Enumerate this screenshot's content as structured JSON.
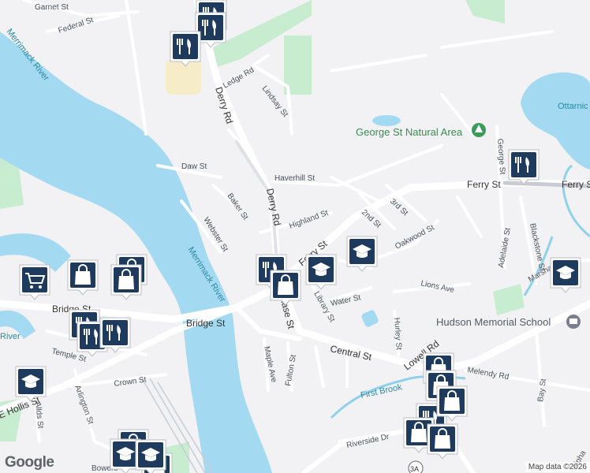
{
  "map": {
    "rivers": {
      "merrimack_top": "Merrimack River",
      "merrimack_mid": "Merrimack River",
      "river_edge": "River"
    },
    "water_bodies": {
      "ottarnic": "Ottarnic"
    },
    "brooks": {
      "first_brook": "First Brook"
    },
    "streets": {
      "garnet": "Garnet St",
      "federal": "Federal St",
      "ledge": "Ledge Rd",
      "lindsay": "Lindsay St",
      "derry_top": "Derry Rd",
      "derry_mid": "Derry Rd",
      "daw": "Daw St",
      "haverhill": "Haverhill St",
      "baker": "Baker St",
      "webster": "Webster St",
      "highland": "Highland St",
      "ferry_main": "Ferry St",
      "ferry_east": "Ferry St",
      "ferry_center": "Ferry St",
      "second": "2nd St",
      "third": "3rd St",
      "oakwood": "Oakwood St",
      "library": "Library St",
      "water": "Water St",
      "chase": "Chase St",
      "central": "Central St",
      "lions": "Lions Ave",
      "hurley": "Hurley St",
      "maple": "Maple Ave",
      "fulton": "Fulton St",
      "bridge_main": "Bridge St",
      "bridge_west": "Bridge St",
      "temple": "Temple St",
      "crown": "Crown St",
      "arlington": "Arlington St",
      "allds": "Allds St",
      "hollis": "E Hollis St",
      "bowers": "Bowers",
      "riverside": "Riverside Dr",
      "lowell": "Lowell Rd",
      "melendy": "Melendy Rd",
      "george": "George St",
      "adelaide": "Adelaide St",
      "blackstone": "Blackstone St",
      "marshall": "Marshall",
      "bay": "Bay St",
      "alpha": "Alpha",
      "route_shield": "3A"
    },
    "pois": {
      "george_st_natural_area": "George St Natural Area",
      "hudson_memorial_school": "Hudson Memorial School"
    },
    "markers": {
      "restaurant": "restaurant-icon",
      "shopping": "shopping-bag-icon",
      "grocery": "shopping-cart-icon",
      "school": "school-icon"
    },
    "colors": {
      "land": "#f2f2f4",
      "water": "#a3daf1",
      "park": "#c8ecd0",
      "road": "#ffffff",
      "highway": "#c9ccd3",
      "marker": "#1e3a5c"
    }
  },
  "footer": {
    "logo": "Google",
    "attribution": "Map data ©2026"
  }
}
